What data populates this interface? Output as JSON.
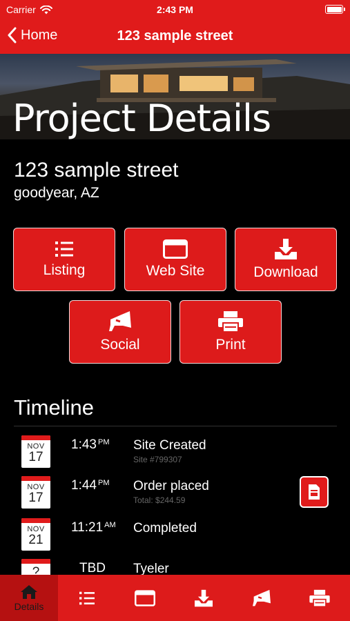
{
  "status": {
    "carrier": "Carrier",
    "time": "2:43 PM"
  },
  "navbar": {
    "back_label": "Home",
    "title": "123 sample street"
  },
  "hero": {
    "title": "Project Details"
  },
  "address": {
    "street": "123 sample street",
    "city": "goodyear, AZ"
  },
  "actions": [
    {
      "label": "Listing",
      "icon": "list-icon"
    },
    {
      "label": "Web Site",
      "icon": "browser-window-icon"
    },
    {
      "label": "Download",
      "icon": "download-tray-icon"
    },
    {
      "label": "Social",
      "icon": "megaphone-icon"
    },
    {
      "label": "Print",
      "icon": "printer-icon"
    }
  ],
  "timeline": {
    "title": "Timeline",
    "items": [
      {
        "month": "NOV",
        "day": "17",
        "time": "1:43",
        "ampm": "PM",
        "event": "Site Created",
        "sub": "Site #799307"
      },
      {
        "month": "NOV",
        "day": "17",
        "time": "1:44",
        "ampm": "PM",
        "event": "Order placed",
        "sub": "Total: $244.59"
      },
      {
        "month": "NOV",
        "day": "21",
        "time": "11:21",
        "ampm": "AM",
        "event": "Completed",
        "sub": ""
      },
      {
        "month": "",
        "day": "?",
        "time": "TBD",
        "ampm": "",
        "event": "Tyeler",
        "sub": ""
      }
    ]
  },
  "tabbar": {
    "tabs": [
      {
        "label": "Details",
        "icon": "home-icon",
        "active": true
      },
      {
        "label": "",
        "icon": "list-icon"
      },
      {
        "label": "",
        "icon": "browser-window-icon"
      },
      {
        "label": "",
        "icon": "download-tray-icon"
      },
      {
        "label": "",
        "icon": "megaphone-icon"
      },
      {
        "label": "",
        "icon": "printer-icon"
      }
    ]
  },
  "colors": {
    "brand_red": "#e01b1b",
    "background": "#000000",
    "text": "#ffffff"
  }
}
